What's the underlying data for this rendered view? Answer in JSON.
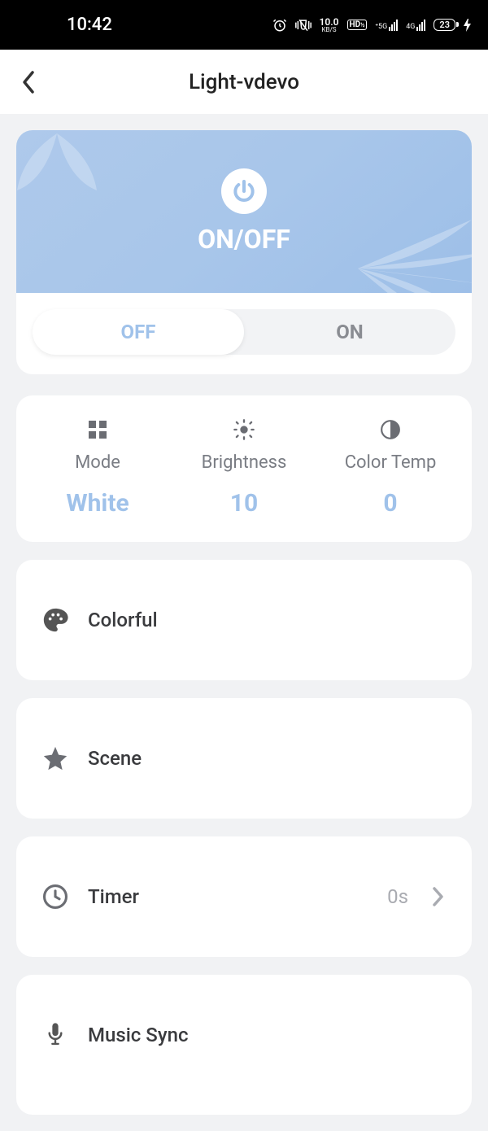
{
  "status": {
    "time": "10:42",
    "net_speed": "10.0",
    "net_unit": "KB/S",
    "hd": "HD",
    "sig1": "5G",
    "sig2": "4G",
    "battery": "23"
  },
  "nav": {
    "title": "Light-vdevo"
  },
  "hero": {
    "label": "ON/OFF"
  },
  "toggle": {
    "off": "OFF",
    "on": "ON"
  },
  "stats": {
    "mode_label": "Mode",
    "mode_value": "White",
    "brightness_label": "Brightness",
    "brightness_value": "10",
    "colortemp_label": "Color Temp",
    "colortemp_value": "0"
  },
  "rows": {
    "colorful": "Colorful",
    "scene": "Scene",
    "timer": "Timer",
    "timer_value": "0s",
    "music": "Music Sync"
  }
}
